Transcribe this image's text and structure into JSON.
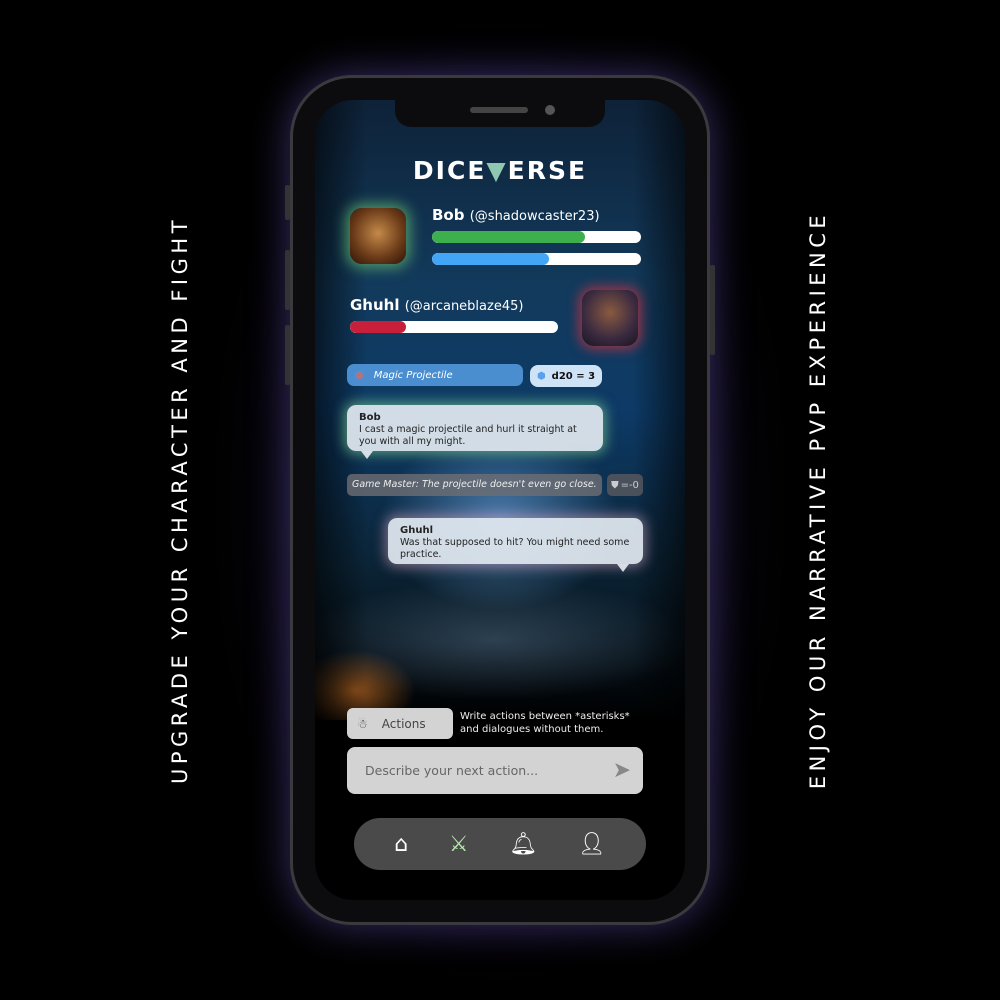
{
  "side_text": {
    "left": "UPGRADE YOUR CHARACTER AND FIGHT",
    "right": "ENJOY OUR NARRATIVE PVP EXPERIENCE"
  },
  "app": {
    "logo": "DICEVERSE",
    "logo_left": "DICE",
    "logo_right": "ERSE"
  },
  "player": {
    "name": "Bob",
    "handle": "(@shadowcaster23)",
    "health": 0.73,
    "mana": 0.56,
    "health_color": "#3daf4c",
    "mana_color": "#42a5f5"
  },
  "opponent": {
    "name": "Ghuhl",
    "handle": "(@arcaneblaze45)",
    "health": 0.27,
    "health_color": "#c8203a"
  },
  "skill": {
    "label": "Magic Projectile",
    "icon": "target-icon"
  },
  "dice_roll": {
    "label": "d20 = 3",
    "icon": "d20-icon"
  },
  "messages": [
    {
      "author": "Bob",
      "text": "I cast a magic projectile and hurl it straight at you with all my might."
    },
    {
      "author": "Ghuhl",
      "text": "Was that supposed to hit? You might need some practice."
    }
  ],
  "game_master": {
    "text": "Game Master: The projectile doesn't even go close.",
    "damage": "=-0",
    "icon": "shield-icon"
  },
  "actions_button": "Actions",
  "hint": "Write actions between *asterisks* and dialogues without them.",
  "input": {
    "placeholder": "Describe your next action..."
  },
  "nav": [
    {
      "icon": "home-icon"
    },
    {
      "icon": "swords-icon",
      "active": true,
      "color": "#b8e6b0"
    },
    {
      "icon": "bell-icon"
    },
    {
      "icon": "user-icon"
    }
  ]
}
